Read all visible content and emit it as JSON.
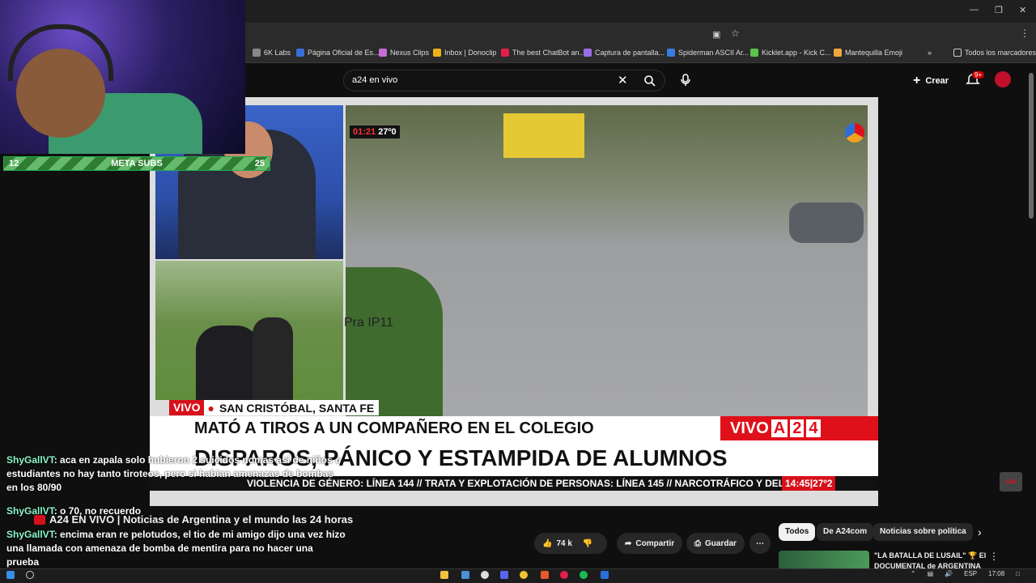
{
  "browser": {
    "bookmarks": [
      {
        "label": "6K Labs",
        "color": "#888888"
      },
      {
        "label": "Página Oficial de Es...",
        "color": "#3a6fd8"
      },
      {
        "label": "Nexus Clips",
        "color": "#c76bd6"
      },
      {
        "label": "Inbox | Donoclip",
        "color": "#f0b21a"
      },
      {
        "label": "The best ChatBot an...",
        "color": "#e0204a"
      },
      {
        "label": "Captura de pantalla...",
        "color": "#9a6ce8"
      },
      {
        "label": "Spiderman ASCII Ar...",
        "color": "#3a7be0"
      },
      {
        "label": "Kicklet.app - Kick C...",
        "color": "#59c24a"
      },
      {
        "label": "Mantequilla Emoji",
        "color": "#f2a640"
      }
    ],
    "all_bookmarks": "Todos los marcadores"
  },
  "youtube": {
    "search_value": "a24 en vivo",
    "create_label": "Crear",
    "notif_badge": "9+"
  },
  "video": {
    "timer": "01:21",
    "temp": "27º0",
    "live_label": "VIVO",
    "location": "SAN CRISTÓBAL, SANTA FE",
    "headline1": "MATÓ A TIROS A UN COMPAÑERO EN EL COLEGIO",
    "headline2": "DISPAROS, PÁNICO Y ESTAMPIDA DE ALUMNOS",
    "brand_vivo": "VIVO",
    "brand_a": "A",
    "brand_2": "2",
    "brand_4": "4",
    "ticker": "VIOLENCIA DE GÉNERO: LÍNEA 144 // TRATA Y EXPLOTACIÓN DE PERSONAS: LÍNEA 145 // NARCOTRÁFICO Y DELITOS FE",
    "ticker_clock": "14:45|27º2",
    "cam_label": "Pra IP11",
    "mini_logo": "A24"
  },
  "overlay": {
    "sub_start": "12",
    "sub_label": "META SUBS",
    "sub_goal": "25"
  },
  "chat": [
    {
      "user": "ShyGallVT",
      "text": ": aca en zapala solo hubieron 2 suicidos nomas asi de niños o estudiantes no hay tanto tiroteos, pero si habian amenazas de bombas en los 80/90"
    },
    {
      "user": "ShyGallVT",
      "text": ": o 70, no recuerdo"
    },
    {
      "user": "ShyGallVT",
      "text": ": encima eran re pelotudos, el tio de mi amigo dijo una vez hizo una llamada con amenaza de bomba de mentira para no hacer una prueba"
    }
  ],
  "below": {
    "title": "A24 EN VIVO | Noticias de Argentina y el mundo las 24 horas",
    "likes": "74 k",
    "share": "Compartir",
    "save": "Guardar"
  },
  "chips": [
    "Todos",
    "De A24com",
    "Noticias sobre política"
  ],
  "related": {
    "title": "\"LA BATALLA DE LUSAIL\" 🏆 El DOCUMENTAL de ARGENTINA"
  },
  "taskbar": {
    "lang": "ESP",
    "time": "17:08"
  }
}
